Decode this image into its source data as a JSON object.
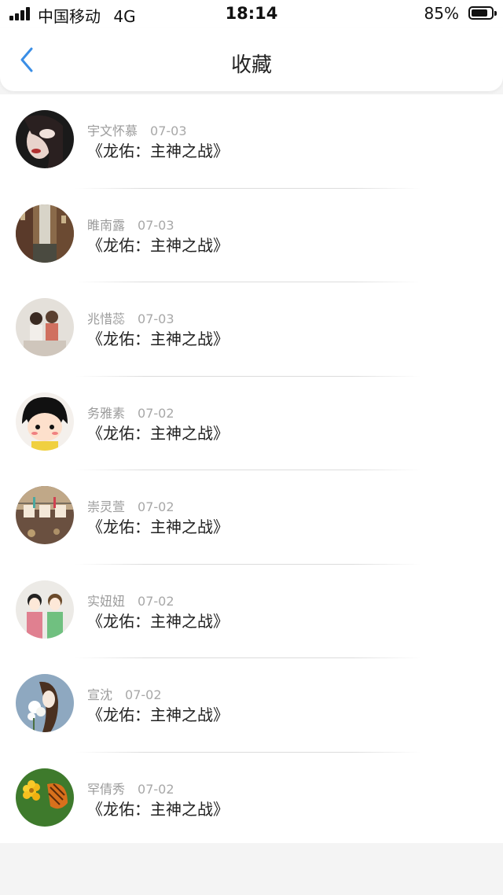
{
  "status_bar": {
    "carrier": "中国移动",
    "network": "4G",
    "time": "18:14",
    "battery_percent": "85%",
    "battery_level": 0.85
  },
  "nav": {
    "title": "收藏",
    "back_icon": "chevron-left-icon",
    "accent_color": "#3a8ee6"
  },
  "favorites": [
    {
      "name": "宇文怀慕",
      "date": "07-03",
      "book": "《龙佑：主神之战》"
    },
    {
      "name": "睢南露",
      "date": "07-03",
      "book": "《龙佑：主神之战》"
    },
    {
      "name": "兆惜蕊",
      "date": "07-03",
      "book": "《龙佑：主神之战》"
    },
    {
      "name": "务雅素",
      "date": "07-02",
      "book": "《龙佑：主神之战》"
    },
    {
      "name": "崇灵萱",
      "date": "07-02",
      "book": "《龙佑：主神之战》"
    },
    {
      "name": "实妞妞",
      "date": "07-02",
      "book": "《龙佑：主神之战》"
    },
    {
      "name": "宣沈",
      "date": "07-02",
      "book": "《龙佑：主神之战》"
    },
    {
      "name": "罕倩秀",
      "date": "07-02",
      "book": "《龙佑：主神之战》"
    }
  ]
}
